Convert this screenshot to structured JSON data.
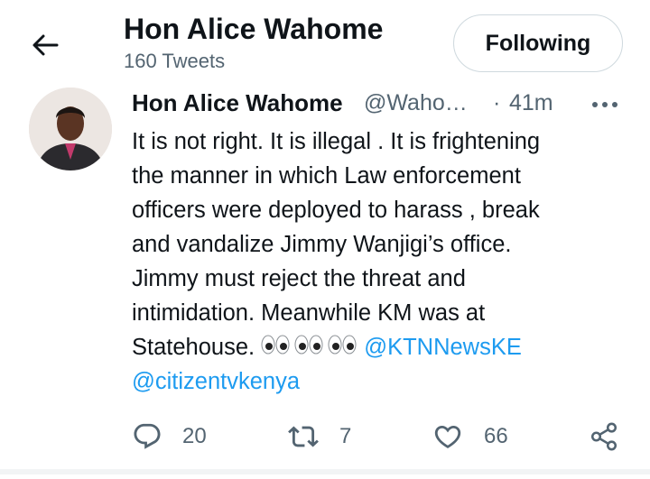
{
  "header": {
    "profile_name": "Hon Alice Wahome",
    "tweet_count": "160 Tweets",
    "following_label": "Following"
  },
  "tweet": {
    "author_name": "Hon Alice Wahome",
    "author_handle": "@Waho…",
    "separator": "·",
    "time": "41m",
    "lines": [
      "It is not right. It is illegal . It is frightening",
      "the manner in which Law enforcement",
      "officers were deployed to harass , break",
      "and vandalize Jimmy Wanjigi’s office.",
      "Jimmy must reject  the threat and",
      "intimidation. Meanwhile KM was at"
    ],
    "line7_text": "Statehouse. ",
    "mention_1": "@KTNNewsKE",
    "mention_2": "@citizentvkenya"
  },
  "actions": {
    "reply_count": "20",
    "retweet_count": "7",
    "like_count": "66"
  },
  "icons": {
    "back": "arrow-left-icon",
    "more": "more-horizontal-icon",
    "eyes": "eyes-emoji-icon",
    "reply": "reply-icon",
    "retweet": "retweet-icon",
    "like": "heart-icon",
    "share": "share-icon"
  },
  "colors": {
    "link": "#1d9bf0",
    "secondary_text": "#536471",
    "primary_text": "#0f1419"
  }
}
